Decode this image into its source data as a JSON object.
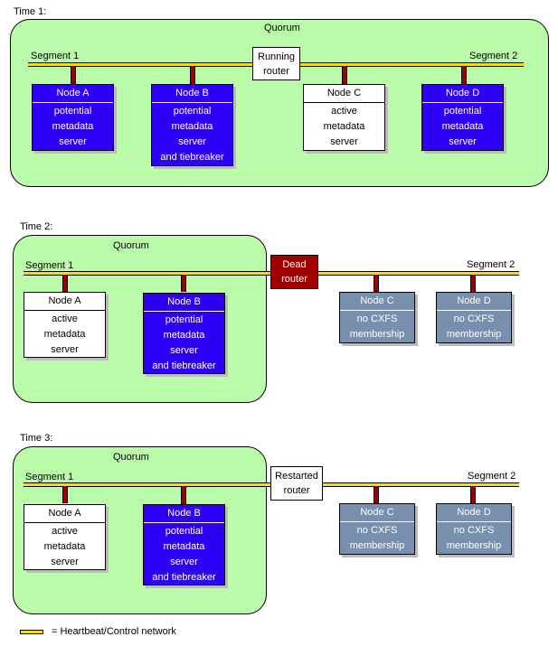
{
  "legend": {
    "label": "= Heartbeat/Control network",
    "network_color": "#fcdc08"
  },
  "colors": {
    "quorum_fill": "#bbfcaa",
    "potential_node": "#2c00f4",
    "active_node": "#ffffff",
    "no_membership_node": "#7890ae",
    "dead_router": "#a00000",
    "drop_line": "#9a0000"
  },
  "panels": [
    {
      "time_label": "Time 1:",
      "quorum_label": "Quorum",
      "segment1_label": "Segment 1",
      "segment2_label": "Segment 2",
      "router": {
        "state": "running",
        "lines": [
          "Running",
          "router"
        ]
      },
      "nodes": [
        {
          "name": "Node A",
          "state": "potential",
          "lines": [
            "potential",
            "metadata",
            "server"
          ]
        },
        {
          "name": "Node B",
          "state": "potential",
          "lines": [
            "potential",
            "metadata",
            "server",
            "and tiebreaker"
          ]
        },
        {
          "name": "Node C",
          "state": "active",
          "lines": [
            "active",
            "metadata",
            "server"
          ]
        },
        {
          "name": "Node D",
          "state": "potential",
          "lines": [
            "potential",
            "metadata",
            "server"
          ]
        }
      ]
    },
    {
      "time_label": "Time 2:",
      "quorum_label": "Quorum",
      "segment1_label": "Segment 1",
      "segment2_label": "Segment 2",
      "router": {
        "state": "dead",
        "lines": [
          "Dead",
          "router"
        ]
      },
      "nodes": [
        {
          "name": "Node A",
          "state": "active",
          "lines": [
            "active",
            "metadata",
            "server"
          ]
        },
        {
          "name": "Node B",
          "state": "potential",
          "lines": [
            "potential",
            "metadata",
            "server",
            "and tiebreaker"
          ]
        },
        {
          "name": "Node C",
          "state": "nomember",
          "lines": [
            "no CXFS",
            "membership"
          ]
        },
        {
          "name": "Node D",
          "state": "nomember",
          "lines": [
            "no CXFS",
            "membership"
          ]
        }
      ]
    },
    {
      "time_label": "Time 3:",
      "quorum_label": "Quorum",
      "segment1_label": "Segment 1",
      "segment2_label": "Segment 2",
      "router": {
        "state": "restarted",
        "lines": [
          "Restarted",
          "router"
        ]
      },
      "nodes": [
        {
          "name": "Node A",
          "state": "active",
          "lines": [
            "active",
            "metadata",
            "server"
          ]
        },
        {
          "name": "Node B",
          "state": "potential",
          "lines": [
            "potential",
            "metadata",
            "server",
            "and tiebreaker"
          ]
        },
        {
          "name": "Node C",
          "state": "nomember",
          "lines": [
            "no CXFS",
            "membership"
          ]
        },
        {
          "name": "Node D",
          "state": "nomember",
          "lines": [
            "no CXFS",
            "membership"
          ]
        }
      ]
    }
  ]
}
